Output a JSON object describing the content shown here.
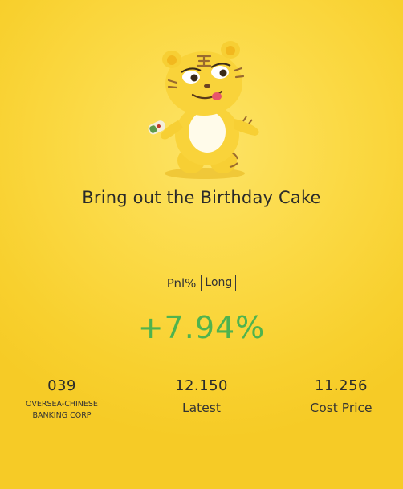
{
  "header": {
    "title": "Bring out the Birthday Cake"
  },
  "position": {
    "pnl_label": "Pnl%",
    "direction": "Long",
    "pnl_percent": "+7.94%"
  },
  "stats": {
    "code": "039",
    "company": "OVERSEA-CHINESE\nBANKING CORP",
    "latest_value": "12.150",
    "latest_label": "Latest",
    "cost_value": "11.256",
    "cost_label": "Cost Price"
  },
  "mascot": {
    "icon": "tiger-mascot-icon"
  },
  "colors": {
    "background": "#F8D02E",
    "gain": "#4FB34E",
    "text": "#2b2b2b"
  }
}
